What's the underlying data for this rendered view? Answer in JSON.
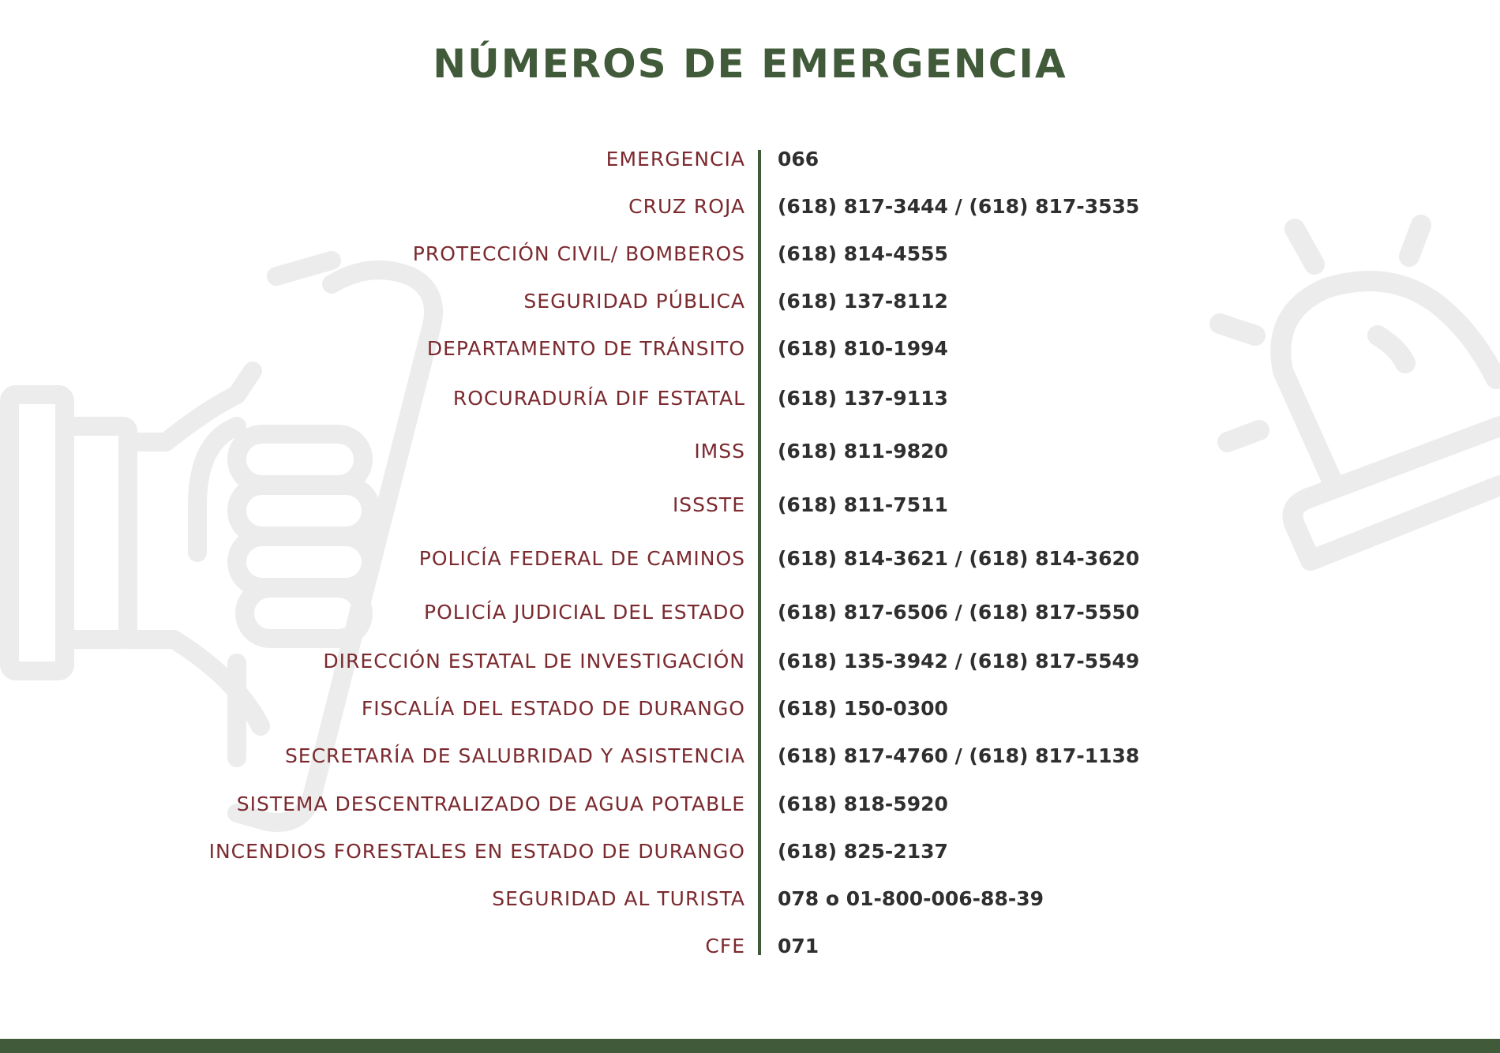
{
  "page": {
    "title": "NÚMEROS DE EMERGENCIA"
  },
  "decorations": {
    "left_icon": "hand-holding-phone-icon",
    "right_icon": "siren-alarm-icon",
    "watermark_color": "#ececec"
  },
  "colors": {
    "title": "#415a3a",
    "label": "#7b2a2f",
    "number": "#2f2f2f",
    "divider": "#415a3a",
    "footer_bar": "#415a3a"
  },
  "contacts": [
    {
      "name": "EMERGENCIA",
      "number": "066"
    },
    {
      "name": "CRUZ ROJA",
      "number": "(618) 817-3444 / (618) 817-3535"
    },
    {
      "name": "PROTECCIÓN CIVIL/ BOMBEROS",
      "number": "(618) 814-4555"
    },
    {
      "name": "SEGURIDAD PÚBLICA",
      "number": "(618) 137-8112"
    },
    {
      "name": "DEPARTAMENTO DE TRÁNSITO",
      "number": "(618) 810-1994"
    },
    {
      "name": "ROCURADURÍA DIF ESTATAL",
      "number": "(618) 137-9113"
    },
    {
      "name": "IMSS",
      "number": "(618) 811-9820"
    },
    {
      "name": "ISSSTE",
      "number": "(618) 811-7511"
    },
    {
      "name": "POLICÍA FEDERAL DE CAMINOS",
      "number": "(618) 814-3621 / (618) 814-3620"
    },
    {
      "name": "POLICÍA JUDICIAL DEL ESTADO",
      "number": "(618) 817-6506 / (618) 817-5550"
    },
    {
      "name": "DIRECCIÓN ESTATAL DE INVESTIGACIÓN",
      "number": "(618) 135-3942 / (618) 817-5549"
    },
    {
      "name": "FISCALÍA DEL ESTADO DE DURANGO",
      "number": "(618) 150-0300"
    },
    {
      "name": "SECRETARÍA DE SALUBRIDAD Y ASISTENCIA",
      "number": "(618) 817-4760 / (618) 817-1138"
    },
    {
      "name": "SISTEMA DESCENTRALIZADO DE AGUA POTABLE",
      "number": "(618) 818-5920"
    },
    {
      "name": "INCENDIOS FORESTALES EN ESTADO DE DURANGO",
      "number": "(618) 825-2137"
    },
    {
      "name": "SEGURIDAD AL TURISTA",
      "number": "078 o 01-800-006-88-39"
    },
    {
      "name": "CFE",
      "number": "071"
    }
  ]
}
